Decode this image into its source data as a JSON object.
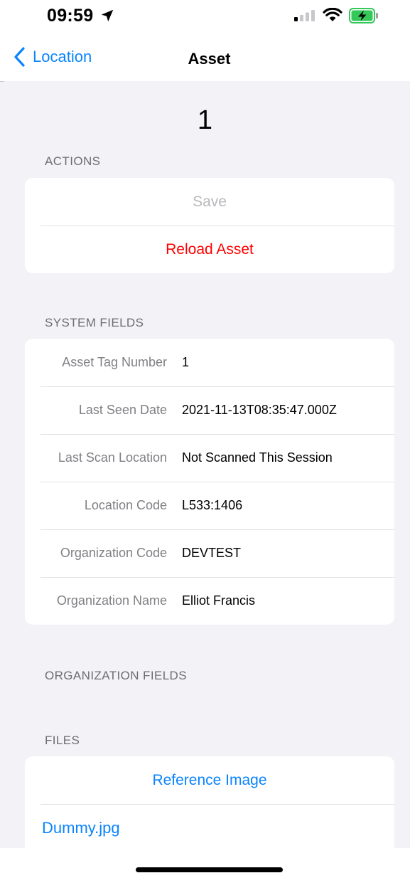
{
  "status_bar": {
    "time": "09:59"
  },
  "nav": {
    "back_label": "Location",
    "title": "Asset"
  },
  "asset": {
    "heading": "1"
  },
  "sections": {
    "actions": "ACTIONS",
    "system_fields": "SYSTEM FIELDS",
    "organization_fields": "ORGANIZATION FIELDS",
    "files": "FILES"
  },
  "actions": {
    "save": "Save",
    "reload": "Reload Asset"
  },
  "system_fields": [
    {
      "label": "Asset Tag Number",
      "value": "1"
    },
    {
      "label": "Last Seen Date",
      "value": "2021-11-13T08:35:47.000Z"
    },
    {
      "label": "Last Scan Location",
      "value": "Not Scanned This Session"
    },
    {
      "label": "Location Code",
      "value": "L533:1406"
    },
    {
      "label": "Organization Code",
      "value": "DEVTEST"
    },
    {
      "label": "Organization Name",
      "value": "Elliot Francis"
    }
  ],
  "files": {
    "reference_image": "Reference Image",
    "file_1": "Dummy.jpg"
  },
  "colors": {
    "accent": "#0a84ff",
    "destructive": "#ff0000",
    "background": "#f2f2f7",
    "battery_charging": "#34c759"
  }
}
